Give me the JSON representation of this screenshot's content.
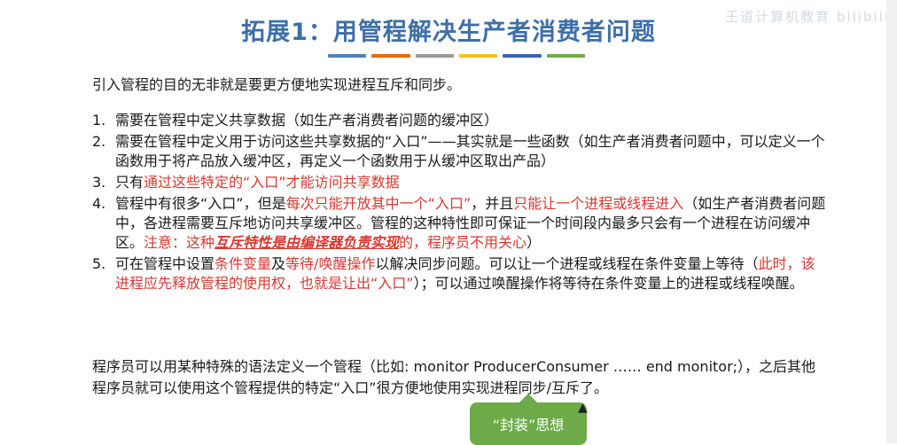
{
  "title": "拓展1：用管程解决生产者消费者问题",
  "watermark": "王道计算机教育 bilibili",
  "stripe_colors": [
    "#4f81bd",
    "#e36c0a",
    "#9a9a9a",
    "#f2c314",
    "#3a66b0",
    "#70ad47"
  ],
  "intro": "引入管程的目的无非就是要更方便地实现进程互斥和同步。",
  "points": [
    {
      "num": "1.",
      "text": "需要在管程中定义共享数据（如生产者消费者问题的缓冲区）"
    },
    {
      "num": "2.",
      "text": "需要在管程中定义用于访问这些共享数据的“入口”——其实就是一些函数（如生产者消费者问题中，可以定义一个函数用于将产品放入缓冲区，再定义一个函数用于从缓冲区取出产品）"
    },
    {
      "num": "3.",
      "a": "只有",
      "b_red": "通过这些特定的“入口”才能访问共享数据"
    },
    {
      "num": "4.",
      "a": "管程中有很多“入口”，但是",
      "b_red": "每次只能开放其中一个“入口”",
      "c": "，并且",
      "d_red": "只能让一个进程或线程进入",
      "e": "（如生产者消费者问题中，各进程需要互斥地访问共享缓冲区。管程的这种特性即可保证一个时间段内最多只会有一个进程在访问缓冲区。",
      "f_red": "注意：这种",
      "g_emph": "互斥特性是由编译器负责实现",
      "h_red": "的，程序员不用关心",
      "i": "）"
    },
    {
      "num": "5.",
      "a": "可在管程中设置",
      "b_red": "条件变量",
      "c": "及",
      "d_red": "等待/唤醒操作",
      "e": "以解决同步问题。可以让一个进程或线程在条件变量上等待（",
      "f_red": "此时，该进程应先释放管程的使用权，也就是让出“入口”",
      "g": "）；可以通过唤醒操作将等待在条件变量上的进程或线程唤醒。"
    }
  ],
  "outro": "程序员可以用某种特殊的语法定义一个管程（比如: monitor ProducerConsumer …… end monitor;），之后其他程序员就可以使用这个管程提供的特定“入口”很方便地使用实现进程同步/互斥了。",
  "callout": "“封装”思想",
  "cursor_icon": "mouse-pointer-icon"
}
